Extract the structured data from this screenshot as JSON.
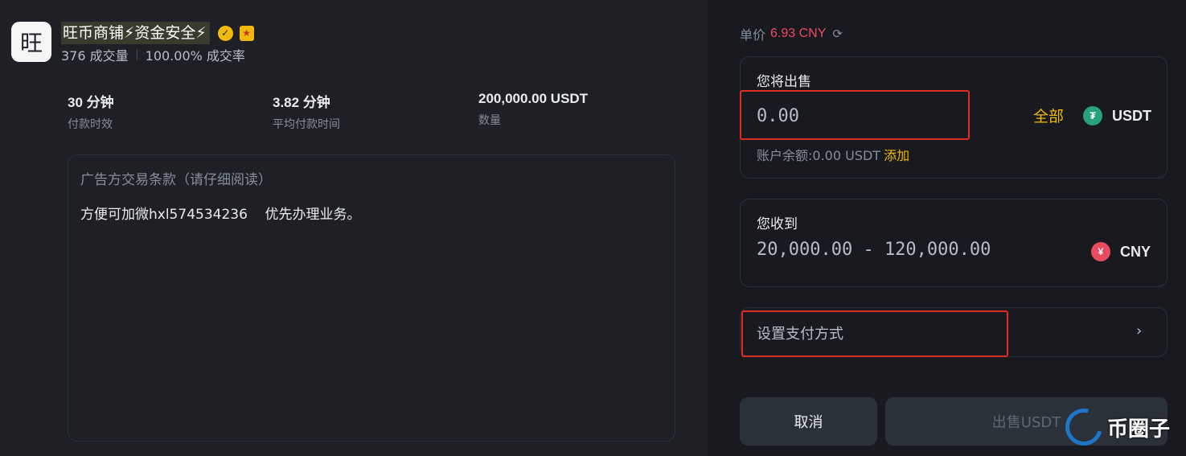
{
  "merchant": {
    "avatar_char": "旺",
    "name": "旺币商铺⚡资金安全⚡",
    "trades": "376 成交量",
    "completion": "100.00% 成交率"
  },
  "stats": [
    {
      "value": "30 分钟",
      "label": "付款时效"
    },
    {
      "value": "3.82 分钟",
      "label": "平均付款时间"
    },
    {
      "value": "200,000.00 USDT",
      "label": "数量"
    }
  ],
  "terms": {
    "title": "广告方交易条款（请仔细阅读）",
    "body": "方便可加微hxl574534236    优先办理业务。"
  },
  "price": {
    "label": "单价",
    "value": "6.93 CNY"
  },
  "sell": {
    "label": "您将出售",
    "placeholder": "0.00",
    "all_label": "全部",
    "coin": "USDT",
    "balance_label": "账户余额:0.00 USDT",
    "add_label": "添加"
  },
  "receive": {
    "label": "您收到",
    "amount": "20,000.00 - 120,000.00",
    "coin": "CNY"
  },
  "payment": {
    "label": "设置支付方式"
  },
  "buttons": {
    "cancel": "取消",
    "sell": "出售USDT"
  },
  "watermark": "币圈子",
  "colors": {
    "accent_yellow": "#f0b90b",
    "price_red": "#f6465d",
    "highlight_red": "#e02b1f",
    "usdt_green": "#26a17b"
  }
}
